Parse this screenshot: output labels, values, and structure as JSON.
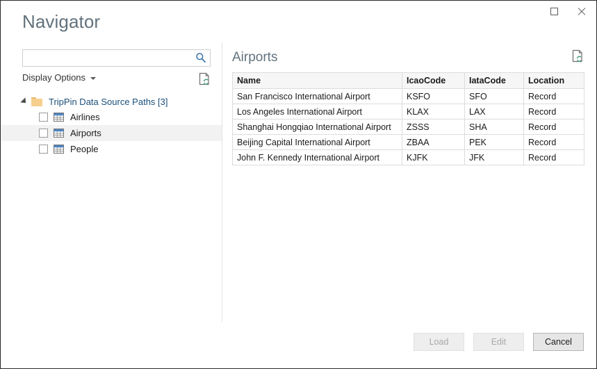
{
  "window": {
    "title": "Navigator",
    "controls": [
      {
        "name": "restore-button",
        "label": "Restore"
      },
      {
        "name": "close-button",
        "label": "Close"
      }
    ]
  },
  "search": {
    "value": "",
    "placeholder": "",
    "icon": "search-icon"
  },
  "display_options": {
    "label": "Display Options",
    "caret_icon": "chevron-down-icon",
    "refresh_icon": "refresh-document-icon"
  },
  "tree": {
    "root": {
      "label": "TripPin Data Source Paths [3]",
      "expanded": true,
      "expander_icon": "triangle-expanded-icon",
      "folder_icon": "folder-icon"
    },
    "items": [
      {
        "label": "Airlines",
        "checked": false,
        "selected": false,
        "icon": "table-icon"
      },
      {
        "label": "Airports",
        "checked": false,
        "selected": true,
        "icon": "table-icon"
      },
      {
        "label": "People",
        "checked": false,
        "selected": false,
        "icon": "table-icon"
      }
    ]
  },
  "preview": {
    "title": "Airports",
    "refresh_icon": "refresh-document-icon",
    "columns": [
      "Name",
      "IcaoCode",
      "IataCode",
      "Location"
    ],
    "rows": [
      [
        "San Francisco International Airport",
        "KSFO",
        "SFO",
        "Record"
      ],
      [
        "Los Angeles International Airport",
        "KLAX",
        "LAX",
        "Record"
      ],
      [
        "Shanghai Hongqiao International Airport",
        "ZSSS",
        "SHA",
        "Record"
      ],
      [
        "Beijing Capital International Airport",
        "ZBAA",
        "PEK",
        "Record"
      ],
      [
        "John F. Kennedy International Airport",
        "KJFK",
        "JFK",
        "Record"
      ]
    ]
  },
  "footer": {
    "buttons": [
      {
        "label": "Load",
        "enabled": false
      },
      {
        "label": "Edit",
        "enabled": false
      },
      {
        "label": "Cancel",
        "enabled": true
      }
    ]
  },
  "colors": {
    "title_text": "#62727d",
    "tree_root_text": "#1a4f7a",
    "search_icon": "#2e6da4",
    "folder": "#f5cf8e",
    "table_icon_header": "#4a86c8",
    "refresh_green": "#4e9e7f",
    "selection": "#f2f2f2",
    "table_header_bg": "#f6f6f6",
    "border": "#dcdcdc"
  }
}
